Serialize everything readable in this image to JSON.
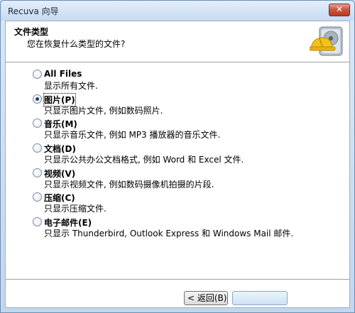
{
  "window": {
    "title": "Recuva 向导",
    "close_glyph": "✕"
  },
  "header": {
    "title": "文件类型",
    "subtitle": "您在恢复什么类型的文件?",
    "icon": "hard-drive-with-hardhat-icon"
  },
  "options": [
    {
      "label": "All Files",
      "description": "显示所有文件.",
      "checked": false
    },
    {
      "label": "图片(P)",
      "description": "只显示图片文件, 例如数码照片.",
      "checked": true
    },
    {
      "label": "音乐(M)",
      "description": "只显示音乐文件, 例如 MP3 播放器的音乐文件.",
      "checked": false
    },
    {
      "label": "文档(D)",
      "description": "只显示公共办公文档格式, 例如 Word 和 Excel 文件.",
      "checked": false
    },
    {
      "label": "视频(V)",
      "description": "只显示视频文件, 例如数码摄像机拍摄的片段.",
      "checked": false
    },
    {
      "label": "压缩(C)",
      "description": "只显示压缩文件.",
      "checked": false
    },
    {
      "label": "电子邮件(E)",
      "description": "只显示 Thunderbird, Outlook Express 和 Windows Mail 邮件.",
      "checked": false
    }
  ],
  "buttons": {
    "back_label": "< 返回(B)"
  },
  "colors": {
    "title_bar": "#c7daf1",
    "close_button": "#c8523a",
    "radio_dot": "#1c3f70"
  }
}
